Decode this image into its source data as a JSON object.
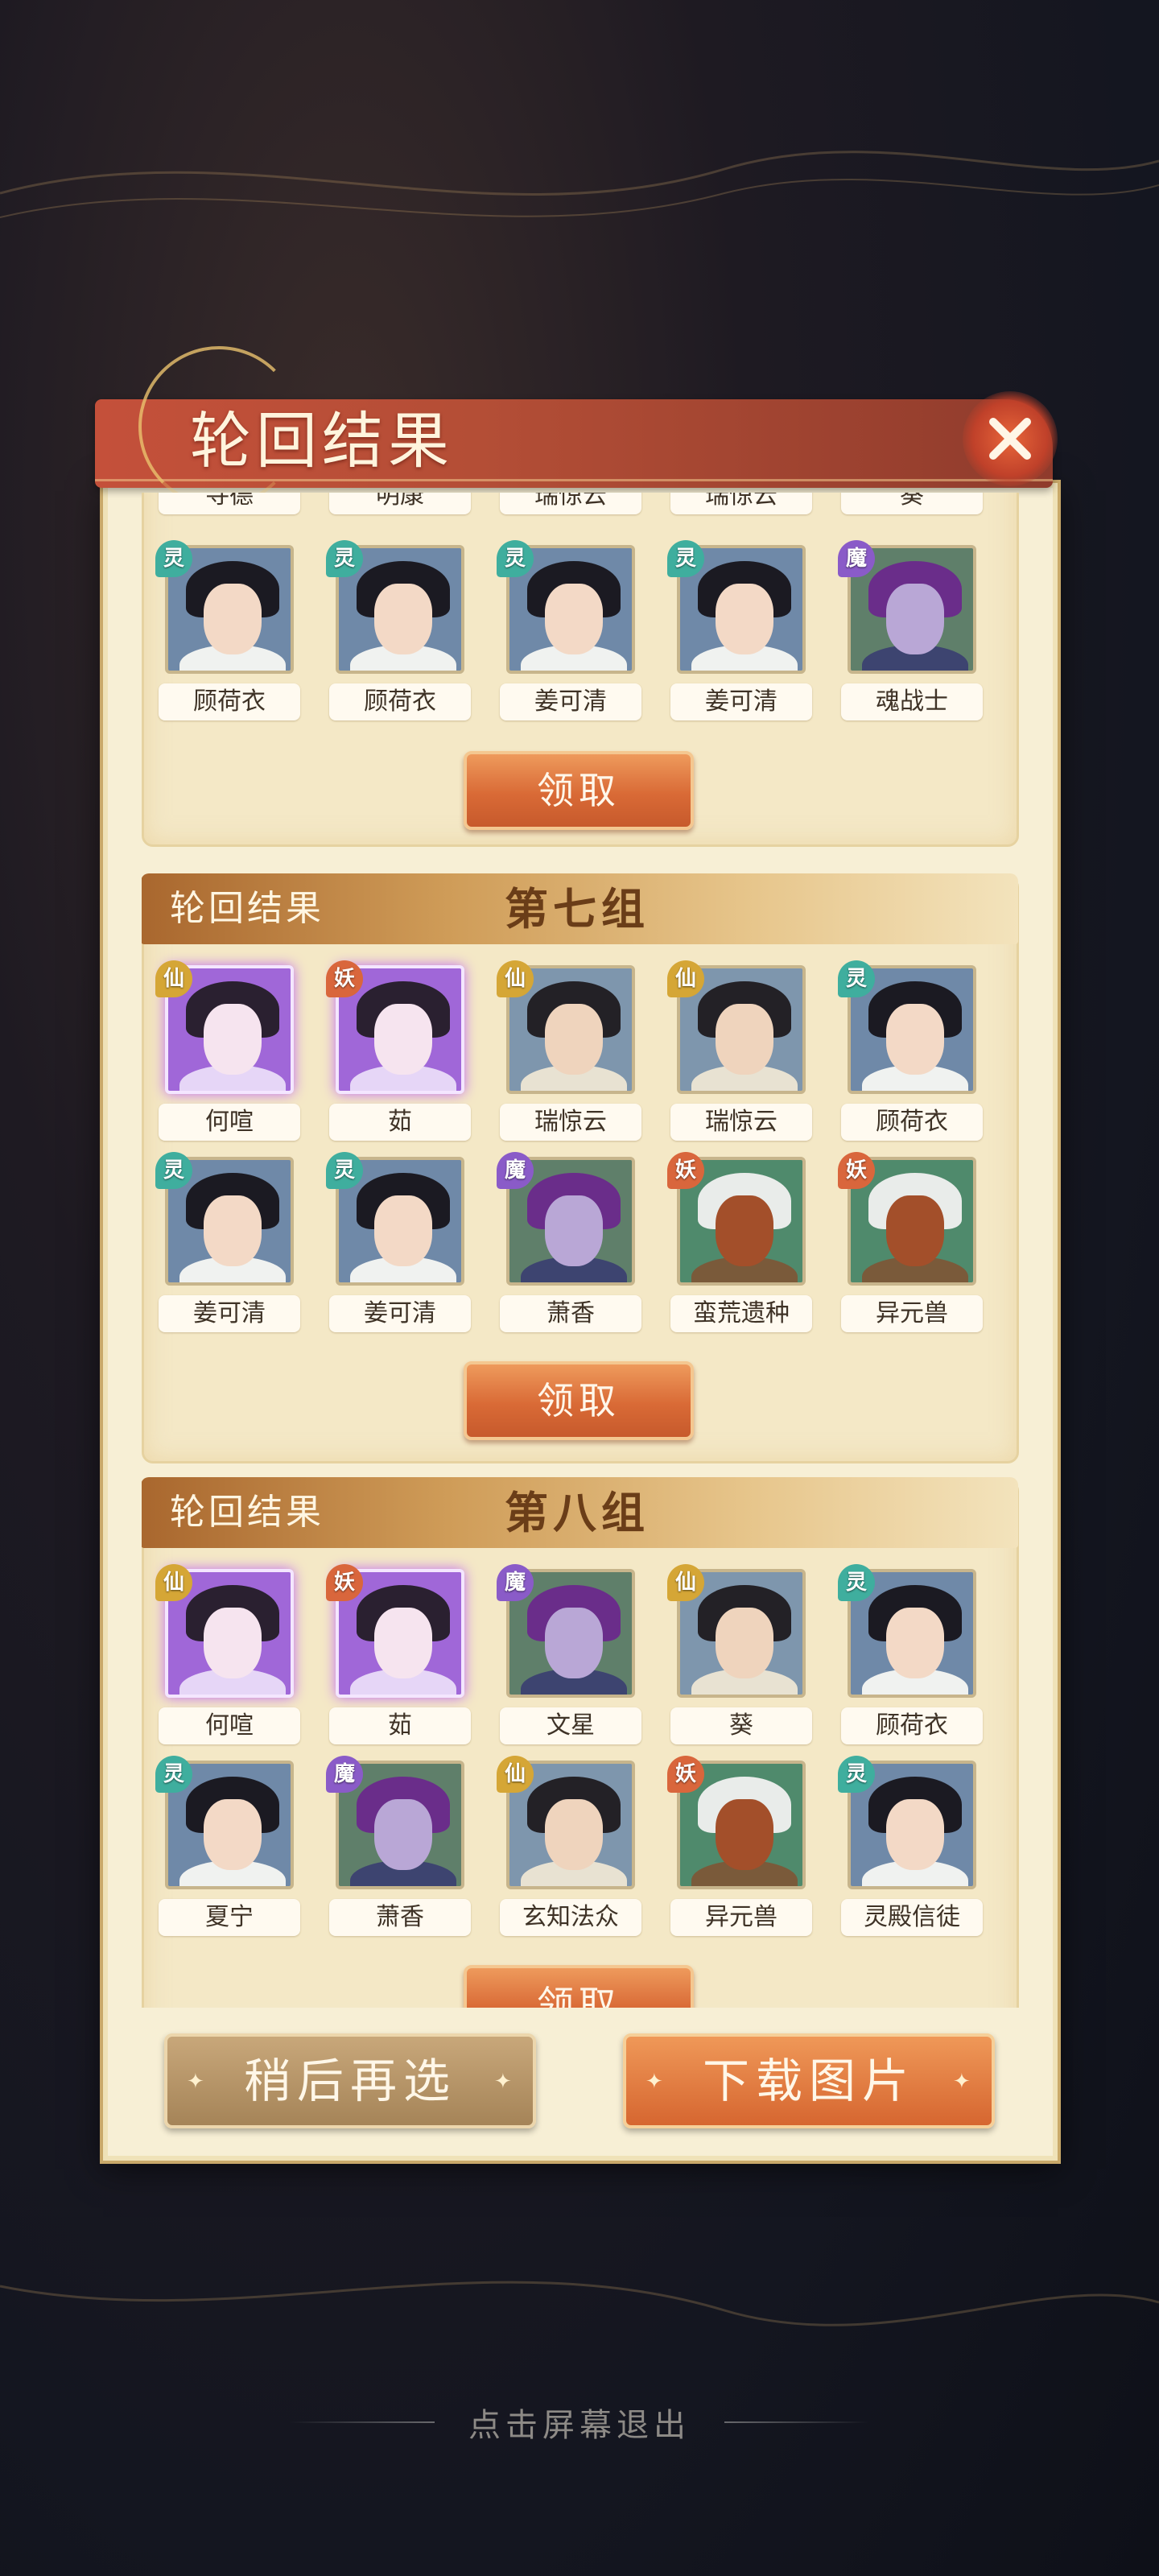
{
  "dialog": {
    "title": "轮回结果",
    "close_icon": "close-x-icon"
  },
  "top_group": {
    "top_partial_names": [
      "寻德",
      "明康",
      "瑞惊云",
      "瑞惊云",
      "葵"
    ],
    "characters": [
      {
        "name": "顾荷衣",
        "badge": "灵",
        "badge_color": "#3fae9e"
      },
      {
        "name": "顾荷衣",
        "badge": "灵",
        "badge_color": "#3fae9e"
      },
      {
        "name": "姜可清",
        "badge": "灵",
        "badge_color": "#3fae9e"
      },
      {
        "name": "姜可清",
        "badge": "灵",
        "badge_color": "#3fae9e"
      },
      {
        "name": "魂战士",
        "badge": "魔",
        "badge_color": "#8a5bc8"
      }
    ],
    "claim_label": "领取"
  },
  "groups": [
    {
      "sub_title": "轮回结果",
      "title": "第七组",
      "row1": [
        {
          "name": "何喧",
          "badge": "仙",
          "badge_color": "#d5a636",
          "rare": true
        },
        {
          "name": "茹",
          "badge": "妖",
          "badge_color": "#d9663c",
          "rare": true
        },
        {
          "name": "瑞惊云",
          "badge": "仙",
          "badge_color": "#d5a636",
          "rare": false
        },
        {
          "name": "瑞惊云",
          "badge": "仙",
          "badge_color": "#d5a636",
          "rare": false
        },
        {
          "name": "顾荷衣",
          "badge": "灵",
          "badge_color": "#3fae9e",
          "rare": false
        }
      ],
      "row2": [
        {
          "name": "姜可清",
          "badge": "灵",
          "badge_color": "#3fae9e",
          "rare": false
        },
        {
          "name": "姜可清",
          "badge": "灵",
          "badge_color": "#3fae9e",
          "rare": false
        },
        {
          "name": "萧香",
          "badge": "魔",
          "badge_color": "#8a5bc8",
          "rare": false
        },
        {
          "name": "蛮荒遗种",
          "badge": "妖",
          "badge_color": "#d9663c",
          "rare": false
        },
        {
          "name": "异元兽",
          "badge": "妖",
          "badge_color": "#d9663c",
          "rare": false
        }
      ],
      "claim_label": "领取"
    },
    {
      "sub_title": "轮回结果",
      "title": "第八组",
      "row1": [
        {
          "name": "何喧",
          "badge": "仙",
          "badge_color": "#d5a636",
          "rare": true
        },
        {
          "name": "茹",
          "badge": "妖",
          "badge_color": "#d9663c",
          "rare": true
        },
        {
          "name": "文星",
          "badge": "魔",
          "badge_color": "#8a5bc8",
          "rare": false
        },
        {
          "name": "葵",
          "badge": "仙",
          "badge_color": "#d5a636",
          "rare": false
        },
        {
          "name": "顾荷衣",
          "badge": "灵",
          "badge_color": "#3fae9e",
          "rare": false
        }
      ],
      "row2": [
        {
          "name": "夏宁",
          "badge": "灵",
          "badge_color": "#3fae9e",
          "rare": false
        },
        {
          "name": "萧香",
          "badge": "魔",
          "badge_color": "#8a5bc8",
          "rare": false
        },
        {
          "name": "玄知法众",
          "badge": "仙",
          "badge_color": "#d5a636",
          "rare": false
        },
        {
          "name": "异元兽",
          "badge": "妖",
          "badge_color": "#d9663c",
          "rare": false
        },
        {
          "name": "灵殿信徒",
          "badge": "灵",
          "badge_color": "#3fae9e",
          "rare": false
        }
      ],
      "claim_label": "领取"
    }
  ],
  "footer": {
    "later_label": "稍后再选",
    "download_label": "下载图片",
    "exit_hint": "点击屏幕退出"
  },
  "colors": {
    "title_bar": "#b44e36",
    "panel": "#f7efd5",
    "claim_button": "#d96a36",
    "later_button": "#a58458"
  }
}
